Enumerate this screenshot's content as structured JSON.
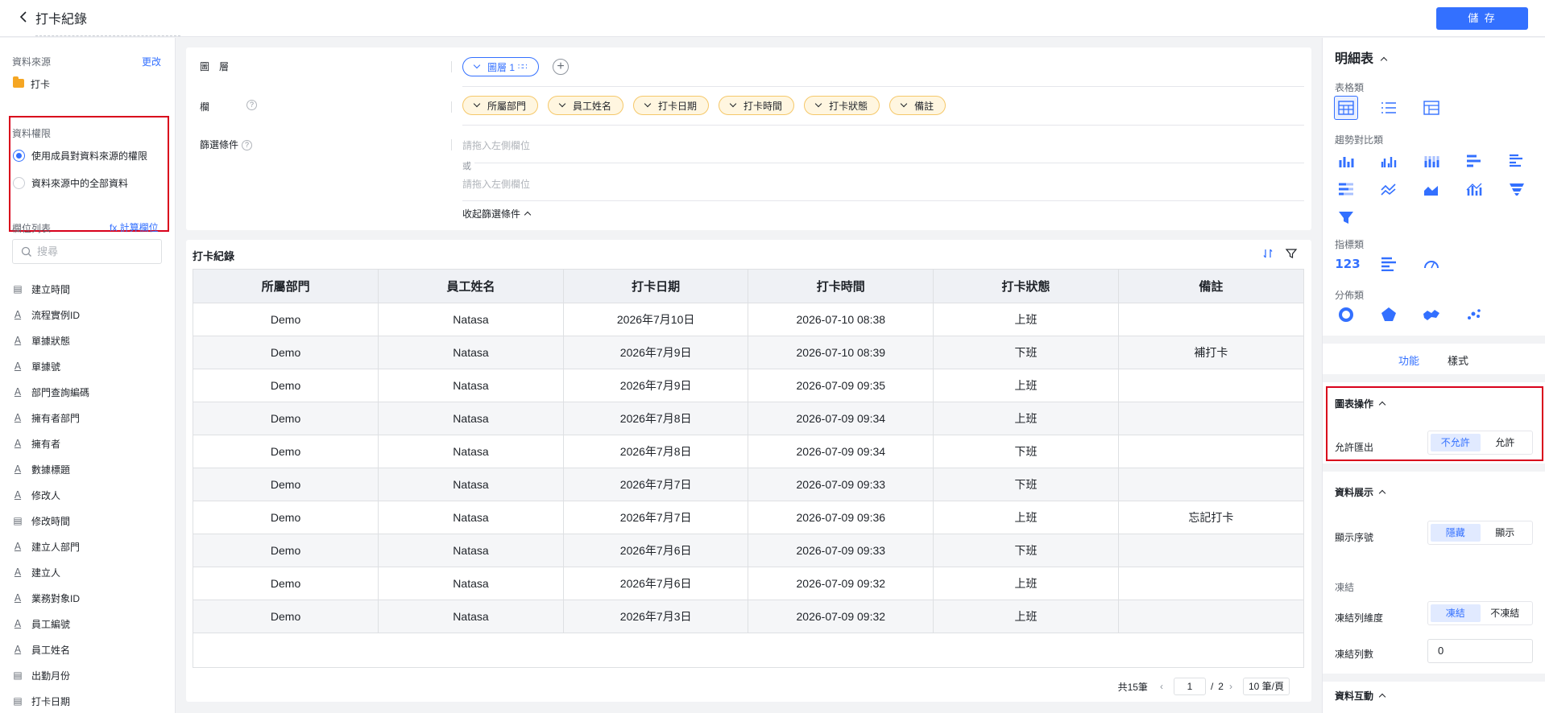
{
  "header": {
    "title": "打卡紀錄",
    "save_label": "儲 存"
  },
  "left": {
    "datasource_label": "資料來源",
    "change_label": "更改",
    "datasource_name": "打卡",
    "permission_label": "資料權限",
    "permission_options": [
      "使用成員對資料來源的權限",
      "資料來源中的全部資料"
    ],
    "permission_selected": 0,
    "fields_label": "欄位列表",
    "calc_field_label": "fx 計算欄位",
    "search_placeholder": "搜尋",
    "fields": [
      {
        "label": "建立時間",
        "type": "date"
      },
      {
        "label": "流程實例ID",
        "type": "text"
      },
      {
        "label": "單據狀態",
        "type": "text"
      },
      {
        "label": "單據號",
        "type": "text"
      },
      {
        "label": "部門查詢編碼",
        "type": "text"
      },
      {
        "label": "擁有者部門",
        "type": "text"
      },
      {
        "label": "擁有者",
        "type": "text"
      },
      {
        "label": "數據標題",
        "type": "text"
      },
      {
        "label": "修改人",
        "type": "text"
      },
      {
        "label": "修改時間",
        "type": "date"
      },
      {
        "label": "建立人部門",
        "type": "text"
      },
      {
        "label": "建立人",
        "type": "text"
      },
      {
        "label": "業務對象ID",
        "type": "text"
      },
      {
        "label": "員工編號",
        "type": "text"
      },
      {
        "label": "員工姓名",
        "type": "text"
      },
      {
        "label": "出勤月份",
        "type": "date"
      },
      {
        "label": "打卡日期",
        "type": "date"
      }
    ]
  },
  "config": {
    "layer_label": "圖　層",
    "layer_chip": "圖層 1",
    "column_label": "欄",
    "column_chips": [
      "所屬部門",
      "員工姓名",
      "打卡日期",
      "打卡時間",
      "打卡狀態",
      "備註"
    ],
    "filter_label": "篩選條件",
    "filter_placeholder_1": "請拖入左側欄位",
    "or_label": "或",
    "filter_placeholder_2": "請拖入左側欄位",
    "collapse_label": "收起篩選條件"
  },
  "table": {
    "title": "打卡紀錄",
    "columns": [
      "所屬部門",
      "員工姓名",
      "打卡日期",
      "打卡時間",
      "打卡狀態",
      "備註"
    ],
    "rows": [
      [
        "Demo",
        "Natasa",
        "2026年7月10日",
        "2026-07-10 08:38",
        "上班",
        ""
      ],
      [
        "Demo",
        "Natasa",
        "2026年7月9日",
        "2026-07-10 08:39",
        "下班",
        "補打卡"
      ],
      [
        "Demo",
        "Natasa",
        "2026年7月9日",
        "2026-07-09 09:35",
        "上班",
        ""
      ],
      [
        "Demo",
        "Natasa",
        "2026年7月8日",
        "2026-07-09 09:34",
        "上班",
        ""
      ],
      [
        "Demo",
        "Natasa",
        "2026年7月8日",
        "2026-07-09 09:34",
        "下班",
        ""
      ],
      [
        "Demo",
        "Natasa",
        "2026年7月7日",
        "2026-07-09 09:33",
        "下班",
        ""
      ],
      [
        "Demo",
        "Natasa",
        "2026年7月7日",
        "2026-07-09 09:36",
        "上班",
        "忘記打卡"
      ],
      [
        "Demo",
        "Natasa",
        "2026年7月6日",
        "2026-07-09 09:33",
        "下班",
        ""
      ],
      [
        "Demo",
        "Natasa",
        "2026年7月6日",
        "2026-07-09 09:32",
        "上班",
        ""
      ],
      [
        "Demo",
        "Natasa",
        "2026年7月3日",
        "2026-07-09 09:32",
        "上班",
        ""
      ]
    ],
    "pager": {
      "total": "共15筆",
      "current": "1",
      "sep": "/",
      "pages": "2",
      "page_size": "10 筆/頁"
    }
  },
  "right": {
    "title": "明細表",
    "cat_table": "表格類",
    "cat_trend": "趨勢對比類",
    "cat_indicator": "指標類",
    "cat_dist": "分佈類",
    "tab_function": "功能",
    "tab_style": "樣式",
    "sec_chart_ops": "圖表操作",
    "allow_export_label": "允許匯出",
    "export_options": [
      "不允許",
      "允許"
    ],
    "sec_data_display": "資料展示",
    "show_index_label": "顯示序號",
    "index_options": [
      "隱藏",
      "顯示"
    ],
    "freeze_label": "凍結",
    "freeze_cols_label": "凍結列維度",
    "freeze_options": [
      "凍結",
      "不凍結"
    ],
    "freeze_count_label": "凍結列數",
    "freeze_count": "0",
    "sec_interaction": "資料互動"
  },
  "colors": {
    "accent": "#3370ff",
    "highlight": "#d9001b",
    "chip_bg": "#fff6e0"
  }
}
